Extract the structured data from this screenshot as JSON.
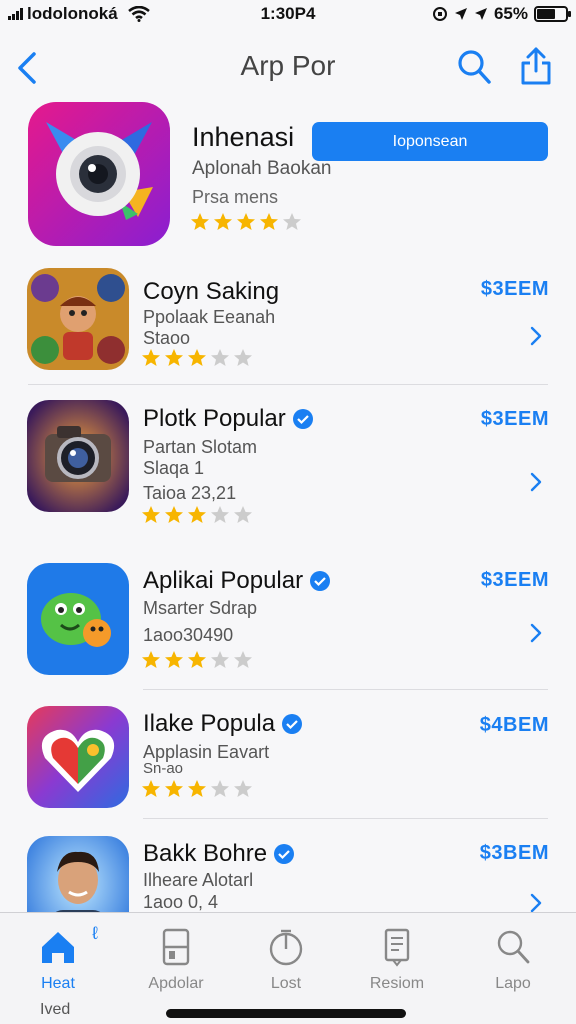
{
  "status_bar": {
    "carrier": "lodolonoká",
    "time": "1:30P4",
    "battery": "65%",
    "battery_level": 0.65
  },
  "nav": {
    "title": "Arp Por"
  },
  "featured": {
    "name": "Inhenasi",
    "subtitle": "Aplonah Baokan",
    "info": "Prsa mens",
    "rating": 4,
    "get_label": "Ioponsean"
  },
  "apps": [
    {
      "name": "Coyn Saking",
      "subtitle": "Ppolaak Eeanah",
      "info": "Staoo",
      "price": "$3EEM",
      "rating": 3,
      "verified": false
    },
    {
      "name": "Plotk Popular",
      "subtitle": "Partan Slotam",
      "info": "Slaqa 1",
      "info2": "Taioa 23,21",
      "price": "$3EEM",
      "rating": 3,
      "verified": true
    },
    {
      "name": "Aplikai Popular",
      "subtitle": "Msarter Sdrap",
      "info": "1aoo30490",
      "price": "$3EEM",
      "rating": 3,
      "verified": true
    },
    {
      "name": "Ilake Popula",
      "subtitle": "Applasin Eavart",
      "info": "Sn-ao",
      "price": "$4BEM",
      "rating": 3,
      "verified": true
    },
    {
      "name": "Bakk Bohre",
      "subtitle": "Ilheare Alotarl",
      "info": "1aoo 0, 4",
      "price": "$3BEM",
      "rating": 0,
      "verified": true
    }
  ],
  "tabs": [
    {
      "label": "Heat",
      "icon": "home-icon",
      "active": true
    },
    {
      "label": "Apdolar",
      "icon": "apps-icon",
      "active": false
    },
    {
      "label": "Lost",
      "icon": "timer-icon",
      "active": false
    },
    {
      "label": "Resiom",
      "icon": "document-icon",
      "active": false
    },
    {
      "label": "Lapo",
      "icon": "search-icon",
      "active": false
    }
  ],
  "tab_badge": "ℓ",
  "tab_foot": "Ived",
  "colors": {
    "accent": "#1a7ff2",
    "star": "#f7b500",
    "star_empty": "#cccccc"
  }
}
